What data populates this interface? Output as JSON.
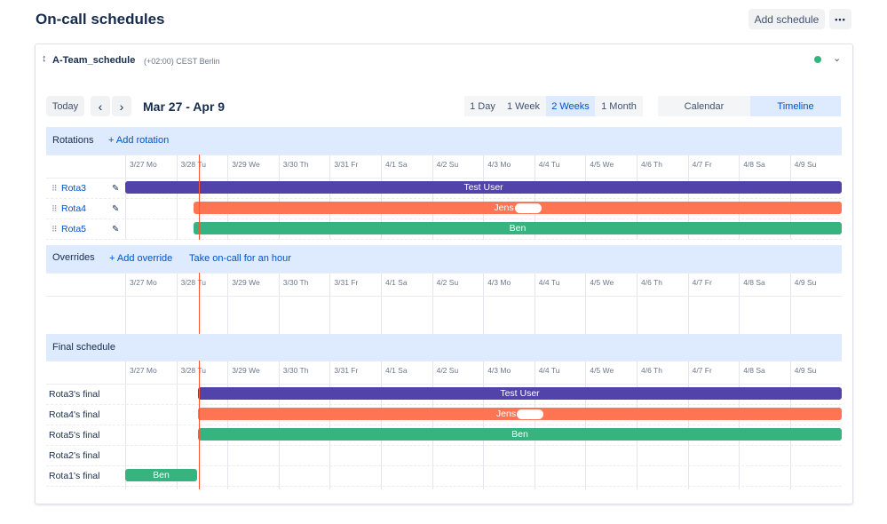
{
  "header": {
    "title": "On-call schedules",
    "add_schedule": "Add schedule",
    "more": "•••"
  },
  "schedule": {
    "name": "A-Team_schedule",
    "timezone": "(+02:00) CEST Berlin",
    "status_color": "#36b37e"
  },
  "toolbar": {
    "today": "Today",
    "prev": "‹",
    "next": "›",
    "date_range": "Mar 27 - Apr 9",
    "ranges": [
      "1 Day",
      "1 Week",
      "2 Weeks",
      "1 Month"
    ],
    "active_range": "2 Weeks",
    "views": [
      "Calendar",
      "Timeline"
    ],
    "active_view": "Timeline"
  },
  "days": [
    "3/27 Mo",
    "3/28 Tu",
    "3/29 We",
    "3/30 Th",
    "3/31 Fr",
    "4/1 Sa",
    "4/2 Su",
    "4/3 Mo",
    "4/4 Tu",
    "4/5 We",
    "4/6 Th",
    "4/7 Fr",
    "4/8 Sa",
    "4/9 Su"
  ],
  "rotations": {
    "title": "Rotations",
    "add_link": "+ Add rotation",
    "rows": [
      {
        "name": "Rota3",
        "assignee": "Test User",
        "color": "#5243aa"
      },
      {
        "name": "Rota4",
        "assignee": "Jens",
        "color": "#ff7452"
      },
      {
        "name": "Rota5",
        "assignee": "Ben",
        "color": "#36b37e"
      }
    ]
  },
  "overrides": {
    "title": "Overrides",
    "add_link": "+ Add override",
    "take_link": "Take on-call for an hour"
  },
  "final": {
    "title": "Final schedule",
    "rows": [
      {
        "name": "Rota3's final",
        "assignee": "Test User",
        "color": "#5243aa"
      },
      {
        "name": "Rota4's final",
        "assignee": "Jens",
        "color": "#ff7452"
      },
      {
        "name": "Rota5's final",
        "assignee": "Ben",
        "color": "#36b37e"
      },
      {
        "name": "Rota2's final",
        "assignee": "",
        "color": ""
      },
      {
        "name": "Rota1's final",
        "assignee": "Ben",
        "color": "#36b37e"
      }
    ]
  }
}
